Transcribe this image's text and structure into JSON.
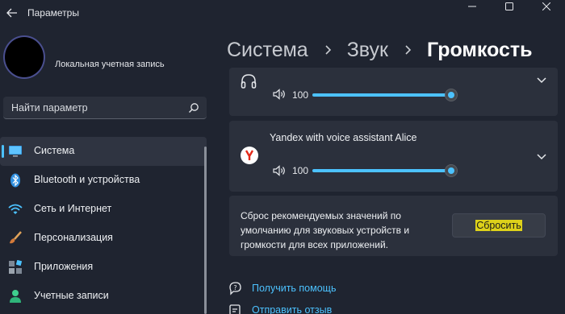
{
  "window": {
    "title": "Параметры"
  },
  "account": {
    "label": "Локальная учетная запись"
  },
  "search": {
    "placeholder": "Найти параметр"
  },
  "sidebar": {
    "items": [
      {
        "label": "Система",
        "icon": "monitor-icon",
        "active": true
      },
      {
        "label": "Bluetooth и устройства",
        "icon": "bluetooth-icon"
      },
      {
        "label": "Сеть и Интернет",
        "icon": "wifi-icon"
      },
      {
        "label": "Персонализация",
        "icon": "brush-icon"
      },
      {
        "label": "Приложения",
        "icon": "apps-icon"
      },
      {
        "label": "Учетные записи",
        "icon": "person-icon"
      }
    ]
  },
  "breadcrumb": {
    "items": [
      "Система",
      "Звук",
      "Громкость"
    ]
  },
  "devices": [
    {
      "name": "",
      "icon": "headphones-icon",
      "volume": "100",
      "level": 1.0
    },
    {
      "name": "Yandex with voice assistant Alice",
      "icon": "yandex-logo",
      "volume": "100",
      "level": 1.0
    }
  ],
  "reset": {
    "text": "Сброс рекомендуемых значений по умолчанию для звуковых устройств и громкости для всех приложений.",
    "button": "Сбросить"
  },
  "links": {
    "help": "Получить помощь",
    "feedback": "Отправить отзыв"
  },
  "colors": {
    "accent": "#4cc2ff",
    "background": "#1f2430",
    "card": "#2b303c",
    "highlight": "#ddd11a"
  }
}
